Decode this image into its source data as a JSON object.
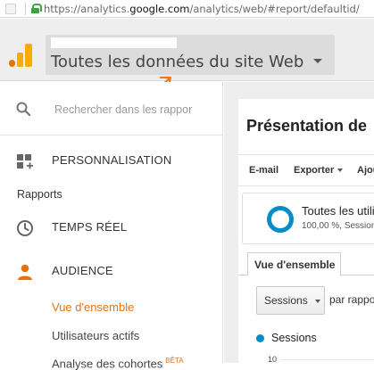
{
  "browser": {
    "url_prefix": "https://analytics.",
    "url_host": "google.com",
    "url_suffix": "/analytics/web/#report/defaultid/"
  },
  "header": {
    "view_title": "Toutes les données du site Web"
  },
  "sidebar": {
    "search_placeholder": "Rechercher dans les rappor",
    "customization_label": "PERSONNALISATION",
    "section_label": "Rapports",
    "realtime_label": "TEMPS RÉEL",
    "audience_label": "AUDIENCE",
    "audience_items": [
      {
        "label": "Vue d'ensemble",
        "active": true
      },
      {
        "label": "Utilisateurs actifs",
        "active": false
      },
      {
        "label": "Analyse des cohortes",
        "active": false,
        "badge": "BÊTA"
      }
    ]
  },
  "main": {
    "heading": "Présentation de",
    "toolbar": {
      "email": "E-mail",
      "export": "Exporter",
      "add": "Ajou"
    },
    "segment": {
      "title": "Toutes les utili",
      "subtitle": "100,00 %, Session",
      "percent": 100
    },
    "tab_active": "Vue d'ensemble",
    "metric_select": "Sessions",
    "par_rapport": "par rappo",
    "legend_series": "Sessions",
    "y_tick": "10"
  },
  "colors": {
    "accent_orange": "#e8710a",
    "series_blue": "#058dc7",
    "secure_green": "#38a63a"
  }
}
